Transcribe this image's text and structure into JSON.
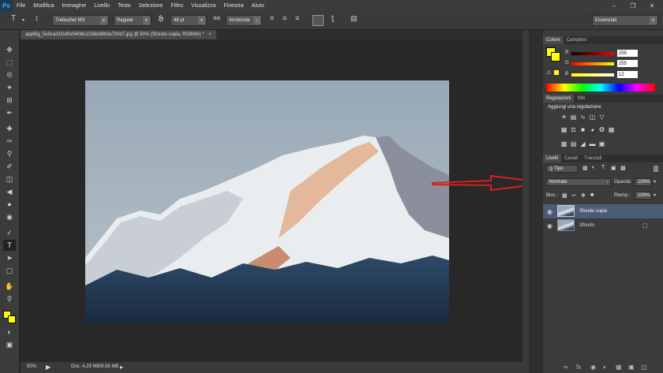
{
  "app": {
    "logo": "Ps"
  },
  "menu": [
    "File",
    "Modifica",
    "Immagine",
    "Livello",
    "Testo",
    "Selezione",
    "Filtro",
    "Visualizza",
    "Finestra",
    "Aiuto"
  ],
  "options": {
    "font_family": "Trebuchet MS",
    "font_style": "Regular",
    "font_size": "48 pt",
    "antialias": "Arrotonda",
    "workspace": "Essenziali"
  },
  "document": {
    "tab_title": "appBig_5e0ca31fcd0e5408e1158dd8b0a720d7.jpg @ 50% (Sfondo copia, RGB/8#) *",
    "zoom": "50%",
    "doc_info": "Doc: 4,29 MB/8,58 MB"
  },
  "color_panel": {
    "tabs": [
      "Colore",
      "Campioni"
    ],
    "r_label": "R",
    "g_label": "G",
    "b_label": "B",
    "r": "255",
    "g": "255",
    "b": "12",
    "foreground": "#ffff0c"
  },
  "adjustments_panel": {
    "tabs": [
      "Regolazioni",
      "Stili"
    ],
    "heading": "Aggiungi una regolazione"
  },
  "layers_panel": {
    "tabs": [
      "Livelli",
      "Canali",
      "Tracciati"
    ],
    "filter": "Tipo",
    "blend_mode": "Normale",
    "opacity_label": "Opacità:",
    "opacity": "100%",
    "lock_label": "Bloc.:",
    "fill_label": "Riemp.:",
    "fill": "100%",
    "layers": [
      {
        "name": "Sfondo copia",
        "selected": true
      },
      {
        "name": "Sfondo",
        "selected": false
      }
    ]
  },
  "colors": {
    "accent_selection": "#4b5b75",
    "annotation_arrow": "#d42020"
  }
}
